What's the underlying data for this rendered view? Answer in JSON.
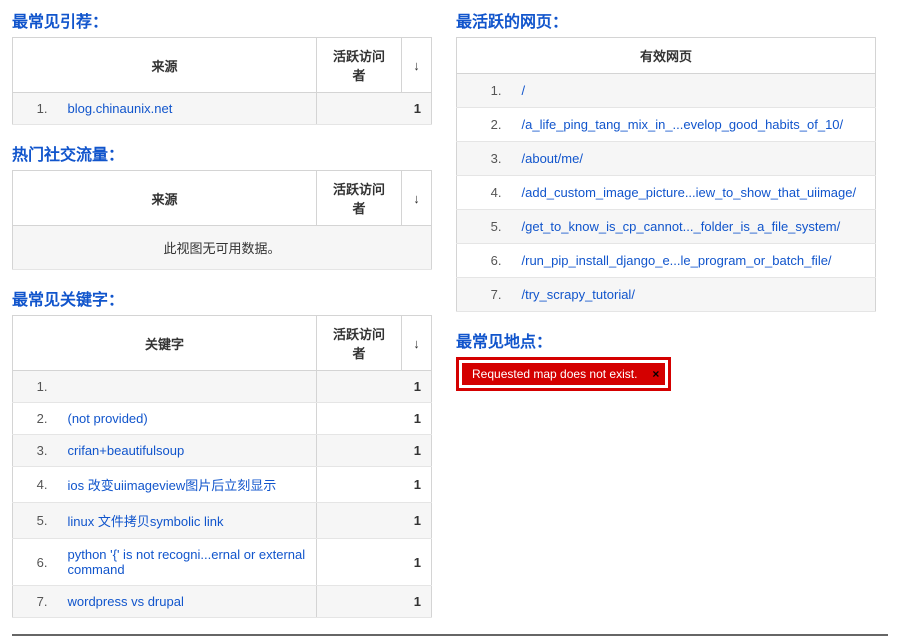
{
  "referrals": {
    "title": "最常见引荐：",
    "col_source": "来源",
    "col_visitors": "活跃访问者",
    "arrow": "↓",
    "rows": [
      {
        "idx": "1.",
        "text": "blog.chinaunix.net",
        "value": "1"
      }
    ]
  },
  "social": {
    "title": "热门社交流量：",
    "col_source": "来源",
    "col_visitors": "活跃访问者",
    "arrow": "↓",
    "empty": "此视图无可用数据。"
  },
  "keywords": {
    "title": "最常见关键字：",
    "col_keyword": "关键字",
    "col_visitors": "活跃访问者",
    "arrow": "↓",
    "rows": [
      {
        "idx": "1.",
        "text": "",
        "value": "1"
      },
      {
        "idx": "2.",
        "text": "(not provided)",
        "value": "1"
      },
      {
        "idx": "3.",
        "text": "crifan+beautifulsoup",
        "value": "1"
      },
      {
        "idx": "4.",
        "text": "ios 改变uiimageview图片后立刻显示",
        "value": "1"
      },
      {
        "idx": "5.",
        "text": "linux 文件拷贝symbolic link",
        "value": "1"
      },
      {
        "idx": "6.",
        "text": "python '{' is not recogni...ernal or external command",
        "value": "1"
      },
      {
        "idx": "7.",
        "text": "wordpress vs drupal",
        "value": "1"
      }
    ]
  },
  "pages": {
    "title": "最活跃的网页：",
    "col_page": "有效网页",
    "rows": [
      {
        "idx": "1.",
        "text": "/"
      },
      {
        "idx": "2.",
        "text": "/a_life_ping_tang_mix_in_...evelop_good_habits_of_10/"
      },
      {
        "idx": "3.",
        "text": "/about/me/"
      },
      {
        "idx": "4.",
        "text": "/add_custom_image_picture...iew_to_show_that_uiimage/"
      },
      {
        "idx": "5.",
        "text": "/get_to_know_is_cp_cannot..._folder_is_a_file_system/"
      },
      {
        "idx": "6.",
        "text": "/run_pip_install_django_e...le_program_or_batch_file/"
      },
      {
        "idx": "7.",
        "text": "/try_scrapy_tutorial/"
      }
    ]
  },
  "locations": {
    "title": "最常见地点：",
    "error": "Requested map does not exist.",
    "close": "×"
  }
}
